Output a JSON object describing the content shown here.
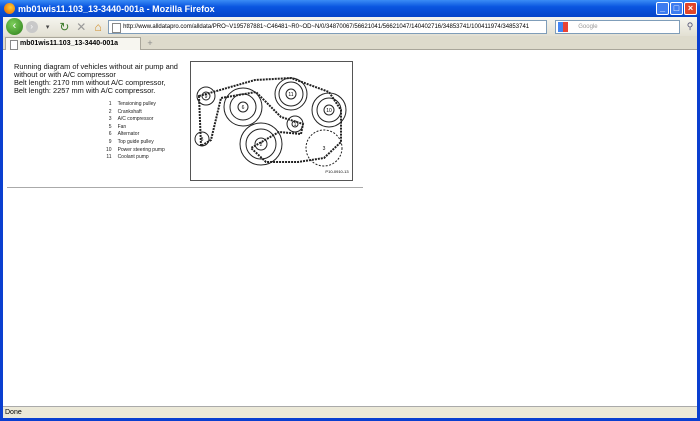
{
  "window": {
    "title": "mb01wis11.103_13-3440-001a - Mozilla Firefox"
  },
  "toolbar": {
    "url": "http://www.alldatapro.com/alldata/PRO~V195787881~C46481~R0~OD~N/0/34870067/56621041/56621047/140402716/34853741/100411974/34853741",
    "search_placeholder": "Google"
  },
  "tabs": [
    {
      "label": "mb01wis11.103_13-3440-001a"
    }
  ],
  "content": {
    "description": [
      "Running diagram of vehicles without air pump and without or with A/C compressor",
      "Belt length: 2170 mm without A/C compressor,",
      "Belt length: 2257 mm with A/C compressor."
    ],
    "legend": [
      {
        "n": "1",
        "label": "Tensioning pulley"
      },
      {
        "n": "2",
        "label": "Crankshaft"
      },
      {
        "n": "3",
        "label": "A/C compressor"
      },
      {
        "n": "5",
        "label": "Fan"
      },
      {
        "n": "6",
        "label": "Alternator"
      },
      {
        "n": "9",
        "label": "Top guide pulley"
      },
      {
        "n": "10",
        "label": "Power steering pump"
      },
      {
        "n": "11",
        "label": "Coolant pump"
      }
    ],
    "diagram_code": "P10-0910-13"
  },
  "status": {
    "text": "Done"
  }
}
